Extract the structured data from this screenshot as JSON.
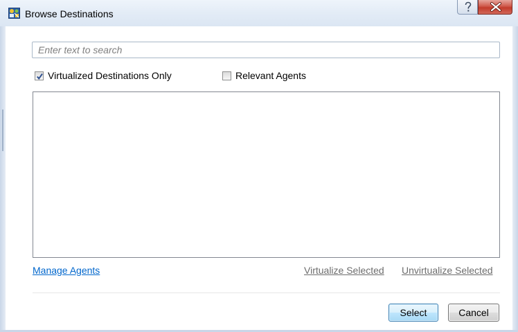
{
  "window": {
    "title": "Browse Destinations",
    "help_icon": "question-mark-icon",
    "close_icon": "x-close-icon",
    "app_icon": "destinations-app-icon"
  },
  "search": {
    "placeholder": "Enter text to search",
    "value": ""
  },
  "filters": {
    "virtualized_only": {
      "label": "Virtualized Destinations Only",
      "checked": true
    },
    "relevant_agents": {
      "label": "Relevant Agents",
      "checked": false
    }
  },
  "destinations": [],
  "links": {
    "manage_agents": "Manage Agents",
    "virtualize_selected": "Virtualize Selected",
    "unvirtualize_selected": "Unvirtualize Selected"
  },
  "buttons": {
    "select": "Select",
    "cancel": "Cancel"
  },
  "colors": {
    "link": "#0066cc",
    "disabled_link": "#6d6d6d",
    "close_button": "#c23b2b",
    "titlebar": "#dbe6f3"
  }
}
